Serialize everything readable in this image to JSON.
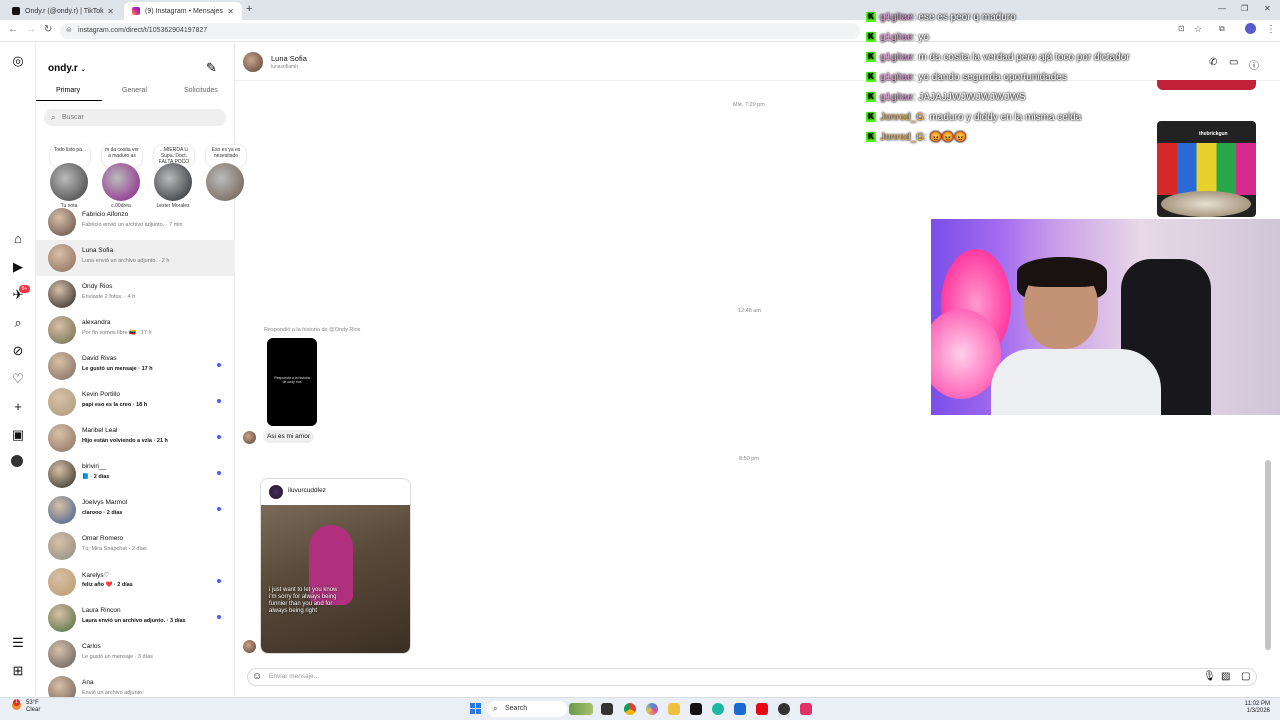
{
  "browser": {
    "tabs": [
      {
        "label": "Ondy.r (@ondy.r) | TikTok",
        "color": "#111111"
      },
      {
        "label": "(9) Instagram • Mensajes",
        "color": "#d6249f"
      }
    ],
    "new_tab": "+",
    "url": "instagram.com/direct/t/105362904197827"
  },
  "sidebar": {
    "username": "ondy.r",
    "tabs": [
      "Primary",
      "General",
      "Solicitudes"
    ],
    "search_placeholder": "Buscar",
    "notif_count": "9+",
    "notes": [
      {
        "bubble": "Todo listo pa...",
        "name": "Tu nota",
        "color": "#3a3a3a"
      },
      {
        "bubble": "m da cosita ver a maduro as",
        "name": "c.00drea",
        "color": "#8a1a8a"
      },
      {
        "bubble": "...MIERDA Li Supa. Doct. FALTA POCO",
        "name": "Lester Morales",
        "color": "#20242a"
      },
      {
        "bubble": "Eso es ya es nesesitado",
        "name": "",
        "color": "#6a5a4a"
      }
    ],
    "conversations": [
      {
        "name": "Fabricio Alfonzo",
        "preview": "Fabricio envió un archivo adjunto. · 7 min",
        "unread": false,
        "selected": false,
        "color": "#5a4a42"
      },
      {
        "name": "Luna Sofia",
        "preview": "Luna envió un archivo adjunto. · 2 h",
        "unread": false,
        "selected": true,
        "color": "#8a6a5a"
      },
      {
        "name": "Ondy Rios",
        "preview": "Enviaste 2 fotos. · 4 h",
        "unread": false,
        "selected": false,
        "color": "#222222"
      },
      {
        "name": "alexandra",
        "preview": "Por fin somos libre 🇻🇪 · 17 h",
        "unread": false,
        "selected": false,
        "color": "#6a6a4a"
      },
      {
        "name": "David Rivas",
        "preview": "Le gustó un mensaje · 17 h",
        "unread": true,
        "selected": false,
        "color": "#7a6a5a"
      },
      {
        "name": "Kevin Portillo",
        "preview": "papi eso es la creo · 18 h",
        "unread": true,
        "selected": false,
        "color": "#a89a7a"
      },
      {
        "name": "Maribel Leal",
        "preview": "Hijo están volviendo a vzla · 21 h",
        "unread": true,
        "selected": false,
        "color": "#8a7060"
      },
      {
        "name": "biriviri__",
        "preview": "📘 · 2 días",
        "unread": true,
        "selected": false,
        "color": "#2a2a20"
      },
      {
        "name": "Joelvys Marmol",
        "preview": "clarooo · 2 días",
        "unread": true,
        "selected": false,
        "color": "#3a5a8a"
      },
      {
        "name": "Omar Romero",
        "preview": "Tú: Mira Snapchat · 2 días",
        "unread": false,
        "selected": false,
        "color": "#8a8a80"
      },
      {
        "name": "Karelys♡",
        "preview": "feliz año ❤️ · 2 días",
        "unread": true,
        "selected": false,
        "color": "#b89a6a"
      },
      {
        "name": "Laura Rincon",
        "preview": "Laura envió un archivo adjunto. · 3 días",
        "unread": true,
        "selected": false,
        "color": "#4a6a3a"
      },
      {
        "name": "Carlos",
        "preview": "Le gustó un mensaje · 3 días",
        "unread": false,
        "selected": false,
        "color": "#5a5a5a"
      },
      {
        "name": "Ana",
        "preview": "Envió un archivo adjunto",
        "unread": false,
        "selected": false,
        "color": "#6a5a50"
      }
    ]
  },
  "chat": {
    "name": "Luna Sofia",
    "handle": "lunasofiamh",
    "timestamps": [
      "Mié, 7:29 pm",
      "12:48 am",
      "8:50 pm"
    ],
    "reply_label": "Respondió a la historia de @Ondy Rios",
    "story_text": "Respuesta a la historia de ondy rios",
    "message": "Asi es mi amor",
    "post_user": "iluvurcuddlez",
    "post_caption": "i just want to let you know i'm sorry for always being funnier than you and for always being right",
    "composer_placeholder": "Enviar mensaje..."
  },
  "stream_chat": [
    {
      "user": "g1gitae",
      "text": ": ese es peor q maduro",
      "orange": false
    },
    {
      "user": "g1gitae",
      "text": ": yo",
      "orange": false
    },
    {
      "user": "g1gitae",
      "text": ": m da cosita la verdad pero ajá toco por dictador",
      "orange": false
    },
    {
      "user": "g1gitae",
      "text": ": yo dando segunda oportunidades",
      "orange": false
    },
    {
      "user": "g1gitae",
      "text": ": JAJAJJWJWJWJWJWS",
      "orange": false
    },
    {
      "user": "Jonrod_G",
      "text": ": maduro y diddy en la misma celda",
      "orange": true
    },
    {
      "user": "Jonrod_G",
      "text": ": 😡😡😡",
      "orange": true
    }
  ],
  "stream_badge": "K",
  "donation_label": "thebrickgun",
  "taskbar": {
    "weather_temp": "53°F",
    "weather_desc": "Clear",
    "weather_badge": "1",
    "search": "Search",
    "time": "11:02 PM",
    "date": "1/3/2026"
  }
}
